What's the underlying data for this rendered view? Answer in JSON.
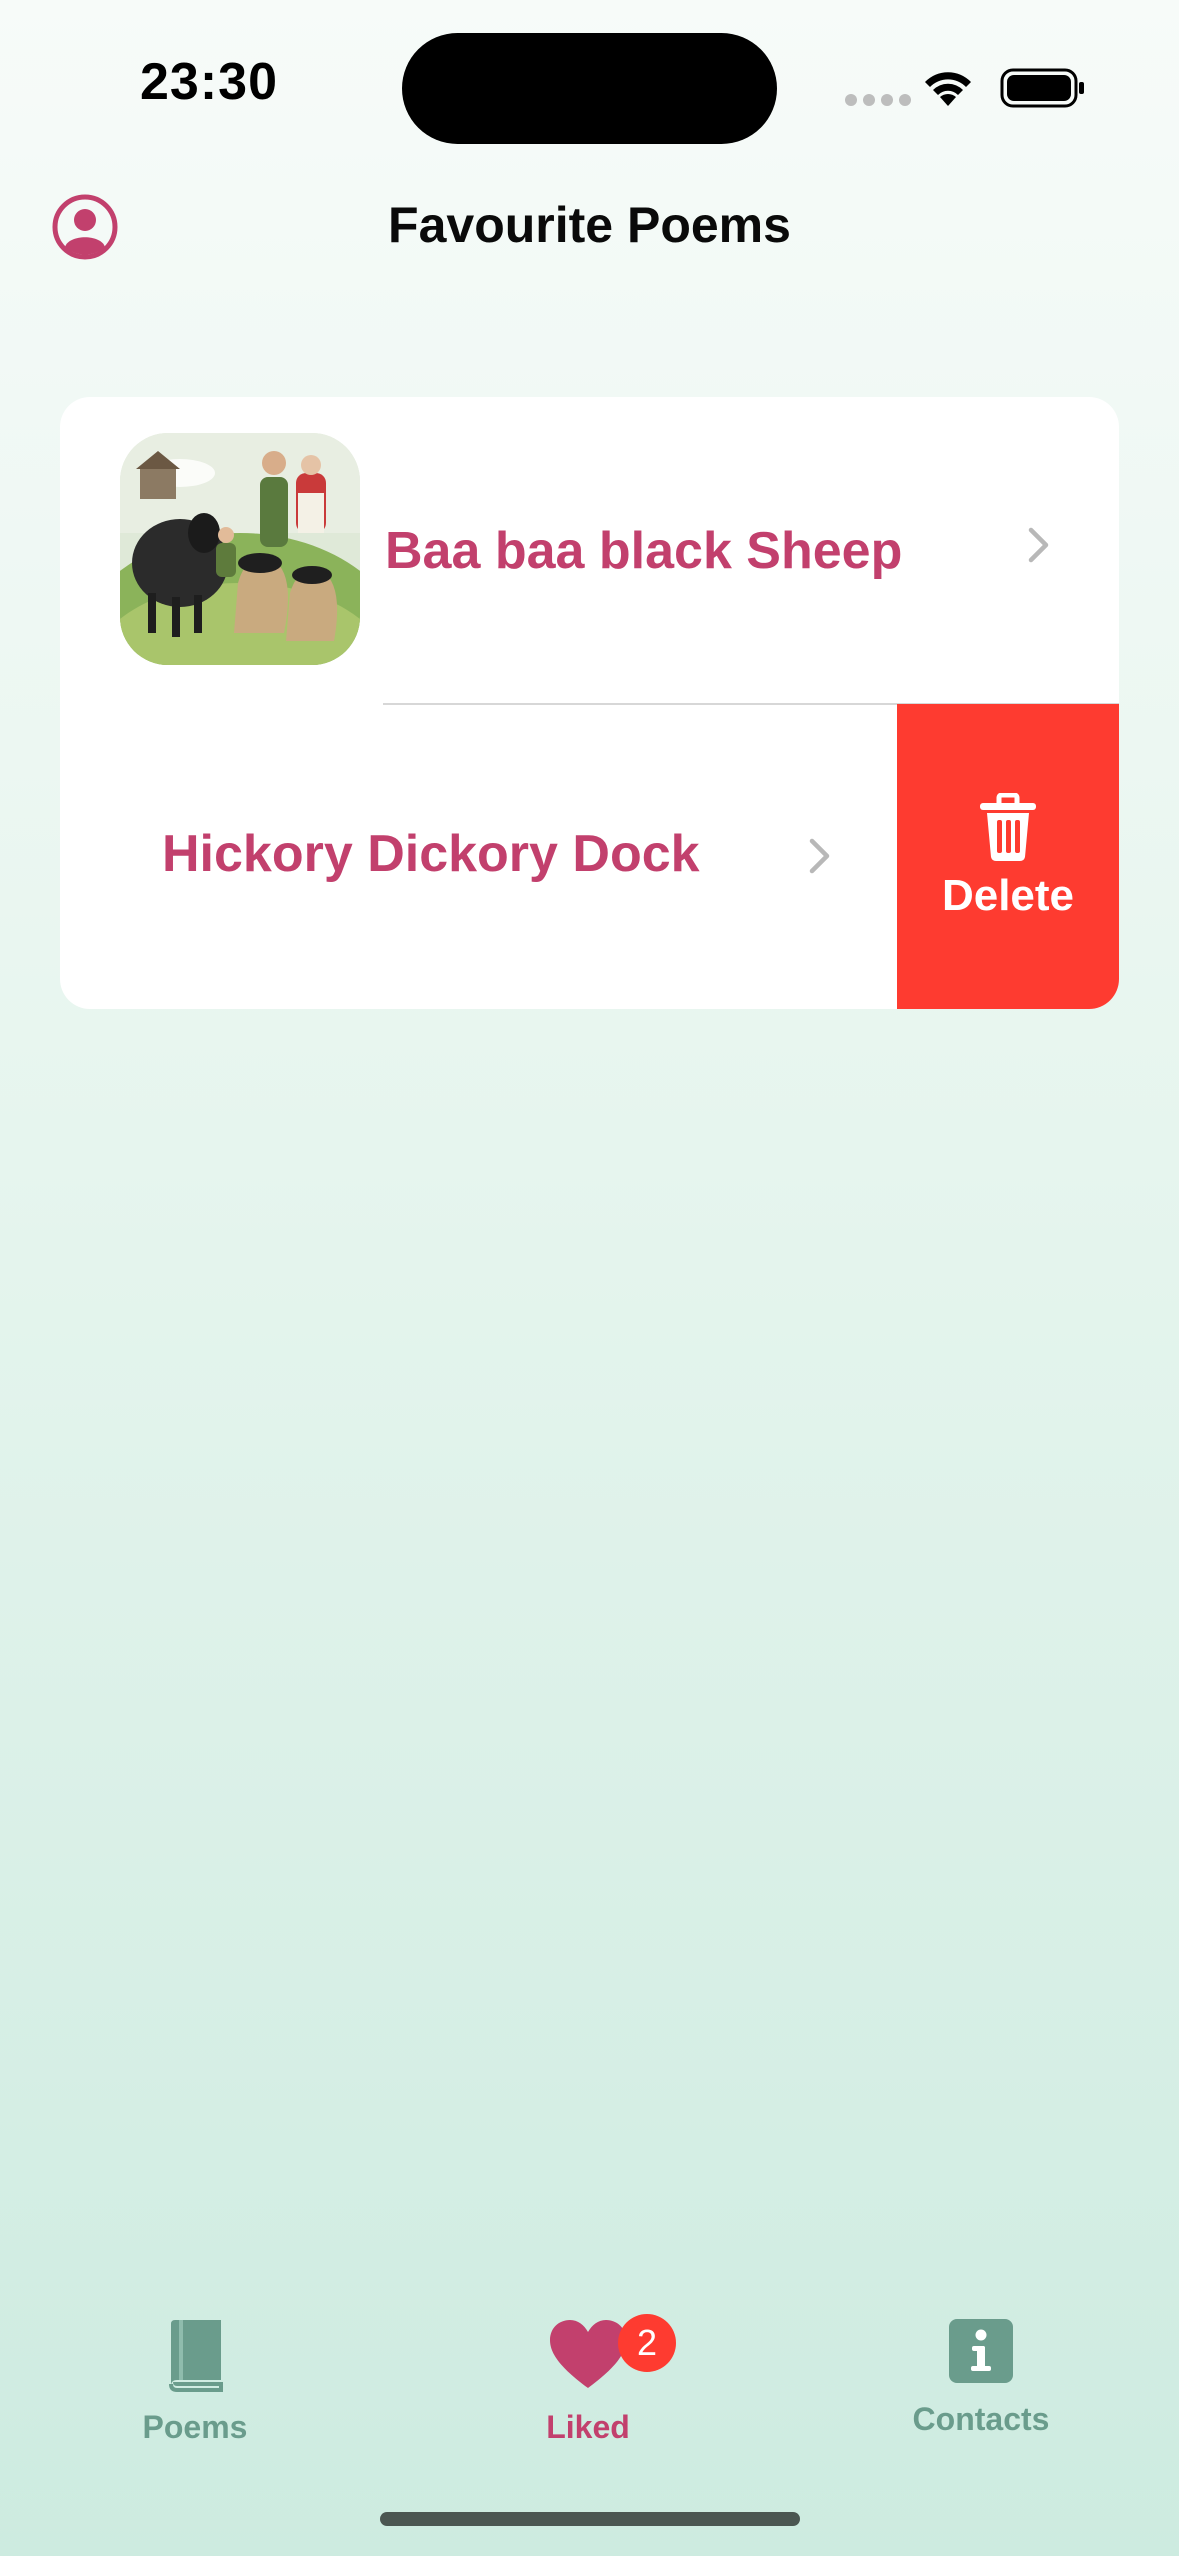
{
  "status_bar": {
    "time": "23:30"
  },
  "header": {
    "title": "Favourite Poems",
    "profile_icon": "person-circle-icon"
  },
  "list": {
    "items": [
      {
        "title": "Baa baa black Sheep",
        "thumbnail": "black-sheep-illustration"
      },
      {
        "title": "Hickory Dickory Dock",
        "thumbnail": null
      }
    ],
    "swipe_action": {
      "label": "Delete",
      "icon": "trash-icon",
      "color": "#fe3b30"
    }
  },
  "tab_bar": {
    "tabs": [
      {
        "label": "Poems",
        "icon": "book-icon",
        "active": false
      },
      {
        "label": "Liked",
        "icon": "heart-icon",
        "active": true,
        "badge": "2"
      },
      {
        "label": "Contacts",
        "icon": "info-icon",
        "active": false
      }
    ]
  },
  "colors": {
    "accent": "#c2406d",
    "tab_inactive": "#6a9c8c",
    "destructive": "#fe3b30"
  }
}
